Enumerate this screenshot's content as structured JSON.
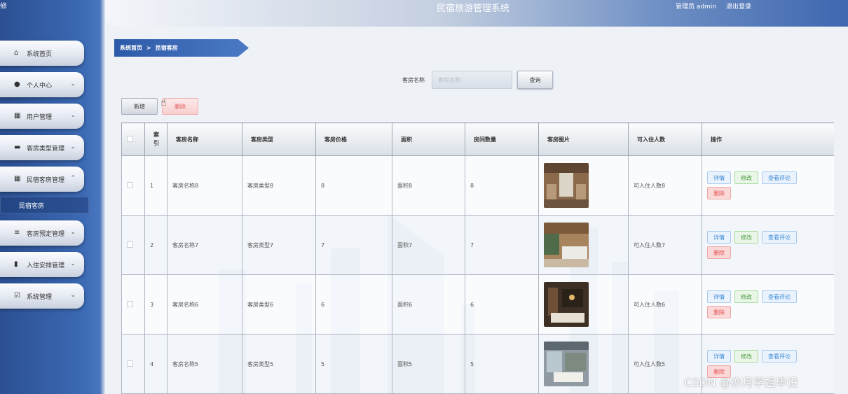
{
  "sidebar": {
    "logo_text": "修",
    "items": [
      {
        "label": "系统首页",
        "icon": "home-icon",
        "has_chevron": false
      },
      {
        "label": "个人中心",
        "icon": "user-icon",
        "has_chevron": true
      },
      {
        "label": "用户管理",
        "icon": "grid-icon",
        "has_chevron": true
      },
      {
        "label": "客房类型管理",
        "icon": "chat-icon",
        "has_chevron": true
      },
      {
        "label": "民宿客房管理",
        "icon": "grid-icon",
        "has_chevron": true,
        "expanded": true
      },
      {
        "label": "客房预定管理",
        "icon": "list-icon",
        "has_chevron": true
      },
      {
        "label": "入住安排管理",
        "icon": "bar-chart-icon",
        "has_chevron": true
      },
      {
        "label": "系统管理",
        "icon": "check-square-icon",
        "has_chevron": true
      }
    ],
    "active_sub_item": "民宿客房"
  },
  "header": {
    "title": "民宿旅游管理系统",
    "user": "管理员 admin",
    "logout": "退出登录"
  },
  "breadcrumb": {
    "home": "系统首页",
    "separator": ">",
    "current": "民宿客房"
  },
  "search": {
    "label": "客房名称",
    "placeholder": "客房名称",
    "button": "查询"
  },
  "actions": {
    "add": "新增",
    "delete": "删除"
  },
  "table": {
    "columns": [
      "索引",
      "客房名称",
      "客房类型",
      "客房价格",
      "面积",
      "房间数量",
      "客房图片",
      "可入住人数",
      "操作"
    ],
    "index_header_lines": [
      "索",
      "引"
    ],
    "op_labels": {
      "detail": "详情",
      "edit": "修改",
      "review": "查看评论",
      "delete": "删除"
    },
    "rows": [
      {
        "index": "1",
        "name": "客房名称8",
        "type": "客房类型8",
        "price": "8",
        "area": "面积8",
        "count": "8",
        "capacity": "可入住人数8"
      },
      {
        "index": "2",
        "name": "客房名称7",
        "type": "客房类型7",
        "price": "7",
        "area": "面积7",
        "count": "7",
        "capacity": "可入住人数7"
      },
      {
        "index": "3",
        "name": "客房名称6",
        "type": "客房类型6",
        "price": "6",
        "area": "面积6",
        "count": "6",
        "capacity": "可入住人数6"
      },
      {
        "index": "4",
        "name": "客房名称5",
        "type": "客房类型5",
        "price": "5",
        "area": "面积5",
        "count": "5",
        "capacity": "可入住人数5"
      }
    ]
  },
  "watermark": "CSDN @亦月学姐毕设",
  "colors": {
    "sidebar": "#3c6ab4",
    "header_accent": "#3e67b0",
    "breadcrumb": "#2d5aa8",
    "danger": "#e05050",
    "success": "#4a9a40",
    "info": "#3d8ad6"
  }
}
